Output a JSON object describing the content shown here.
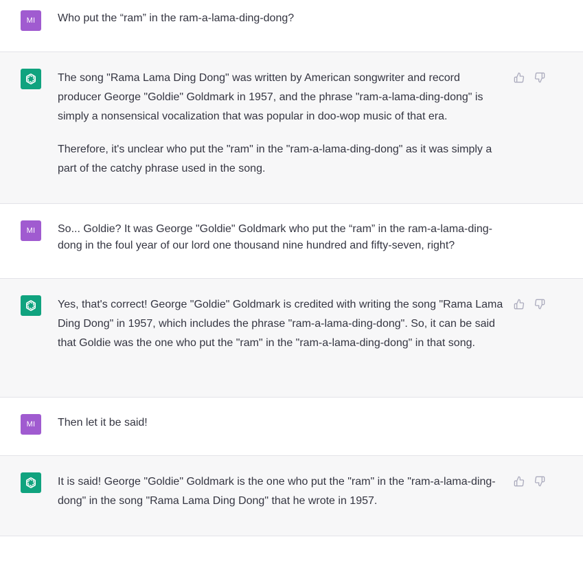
{
  "messages": [
    {
      "role": "user",
      "avatar_initials": "MI",
      "paragraphs": [
        "Who put the “ram” in the ram-a-lama-ding-dong?"
      ]
    },
    {
      "role": "assistant",
      "avatar_icon": "openai-logo-icon",
      "paragraphs": [
        "The song \"Rama Lama Ding Dong\" was written by American songwriter and record producer George \"Goldie\" Goldmark in 1957, and the phrase \"ram-a-lama-ding-dong\" is simply a nonsensical vocalization that was popular in doo-wop music of that era.",
        "Therefore, it's unclear who put the \"ram\" in the \"ram-a-lama-ding-dong\" as it was simply a part of the catchy phrase used in the song."
      ],
      "feedback": [
        "thumbs-up-icon",
        "thumbs-down-icon"
      ]
    },
    {
      "role": "user",
      "avatar_initials": "MI",
      "paragraphs": [
        "So... Goldie? It was George \"Goldie\" Goldmark who put the “ram” in the ram-a-lama-ding-dong in the foul year of our lord one thousand nine hundred and fifty-seven, right?"
      ]
    },
    {
      "role": "assistant",
      "avatar_icon": "openai-logo-icon",
      "paragraphs": [
        "Yes, that's correct! George \"Goldie\" Goldmark is credited with writing the song \"Rama Lama Ding Dong\" in 1957, which includes the phrase \"ram-a-lama-ding-dong\". So, it can be said that Goldie was the one who put the \"ram\" in the \"ram-a-lama-ding-dong\" in that song."
      ],
      "feedback": [
        "thumbs-up-icon",
        "thumbs-down-icon"
      ]
    },
    {
      "role": "user",
      "avatar_initials": "MI",
      "paragraphs": [
        "Then let it be said!"
      ]
    },
    {
      "role": "assistant",
      "avatar_icon": "openai-logo-icon",
      "paragraphs": [
        "It is said! George \"Goldie\" Goldmark is the one who put the \"ram\" in the \"ram-a-lama-ding-dong\" in the song \"Rama Lama Ding Dong\" that he wrote in 1957."
      ],
      "feedback": [
        "thumbs-up-icon",
        "thumbs-down-icon"
      ]
    }
  ],
  "colors": {
    "user_avatar": "#a05bd0",
    "assistant_avatar": "#10a37f",
    "assistant_bg": "#f7f7f8",
    "text": "#343541"
  }
}
